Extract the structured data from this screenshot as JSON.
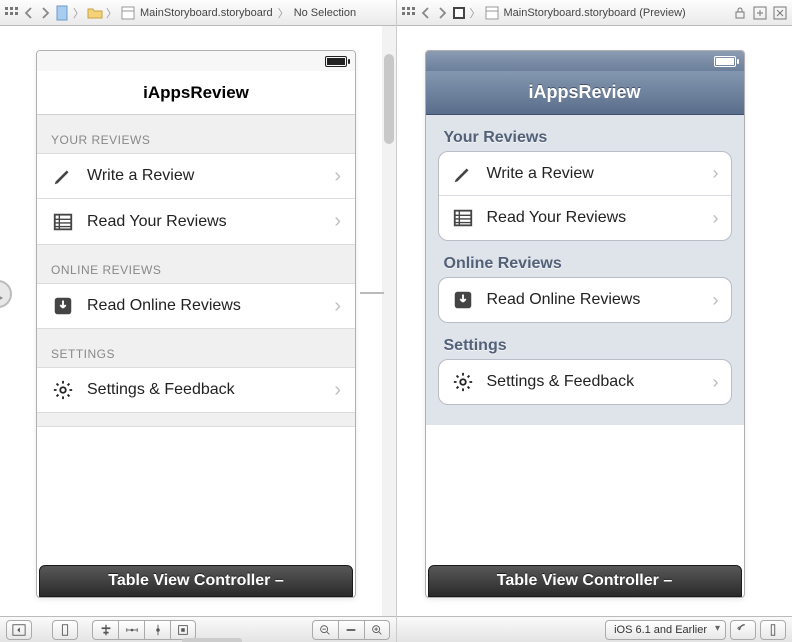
{
  "left": {
    "toolbar": {
      "file_label": "MainStoryboard.storyboard",
      "selection_label": "No Selection"
    },
    "phone": {
      "title": "iAppsReview",
      "sections": [
        {
          "header": "YOUR REVIEWS",
          "cells": [
            {
              "icon": "pencil",
              "label": "Write a Review"
            },
            {
              "icon": "list",
              "label": "Read Your Reviews"
            }
          ]
        },
        {
          "header": "ONLINE REVIEWS",
          "cells": [
            {
              "icon": "download",
              "label": "Read Online Reviews"
            }
          ]
        },
        {
          "header": "SETTINGS",
          "cells": [
            {
              "icon": "gear",
              "label": "Settings & Feedback"
            }
          ]
        }
      ],
      "controller_label": "Table View Controller –"
    }
  },
  "right": {
    "toolbar": {
      "file_label": "MainStoryboard.storyboard (Preview)"
    },
    "phone": {
      "title": "iAppsReview",
      "sections": [
        {
          "header": "Your Reviews",
          "cells": [
            {
              "icon": "pencil",
              "label": "Write a Review"
            },
            {
              "icon": "list",
              "label": "Read Your Reviews"
            }
          ]
        },
        {
          "header": "Online Reviews",
          "cells": [
            {
              "icon": "download",
              "label": "Read Online Reviews"
            }
          ]
        },
        {
          "header": "Settings",
          "cells": [
            {
              "icon": "gear",
              "label": "Settings & Feedback"
            }
          ]
        }
      ],
      "controller_label": "Table View Controller –"
    },
    "preview_target": "iOS 6.1 and Earlier"
  }
}
